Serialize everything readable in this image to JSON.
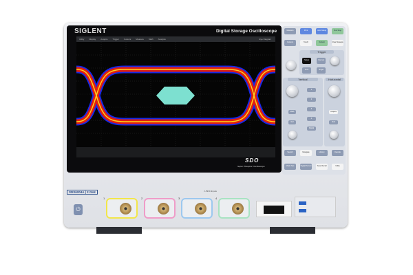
{
  "brand": "SIGLENT",
  "title": "Digital Storage Oscilloscope",
  "menu": [
    "Utility",
    "Display",
    "Acquire",
    "Trigger",
    "Cursors",
    "Measure",
    "Math",
    "Analysis"
  ],
  "menu_right": "Eye Diagram",
  "series": "SDO",
  "series_sub": "Super Phosphor Oscilloscope",
  "panel": {
    "row1": [
      "Measure",
      "Print",
      "Auto Setup",
      "Run Stop"
    ],
    "row2": [
      "Cursors",
      "Touch",
      "Default",
      "Clear Sweeps"
    ],
    "trigger": {
      "header": "Trigger",
      "buttons": [
        "Setup",
        "Normal",
        "Auto",
        "Single"
      ]
    },
    "vertical": {
      "header": "Vertical",
      "buttons": [
        "1",
        "2",
        "3",
        "4",
        "Digital",
        "Math",
        "Ref"
      ]
    },
    "horizontal": {
      "header": "Horizontal",
      "buttons": [
        "Acquire",
        "Roll"
      ]
    },
    "row3": [
      "Search",
      "Navigate",
      "History",
      "Decode"
    ],
    "row4": [
      "Mask Test",
      "Digital Persist",
      "Save Recall",
      "Utility"
    ]
  },
  "front": {
    "model": "SDS6204A",
    "bandwidth": "2 GHz",
    "channels": [
      "1",
      "2",
      "3",
      "4"
    ],
    "warning": "BNC Inputs"
  },
  "colors": {
    "ch1": "#f2e64a",
    "ch2": "#ef9cc8",
    "ch3": "#9cc8ef",
    "ch4": "#a8e3c2",
    "eye_mask": "#7de0d0"
  }
}
